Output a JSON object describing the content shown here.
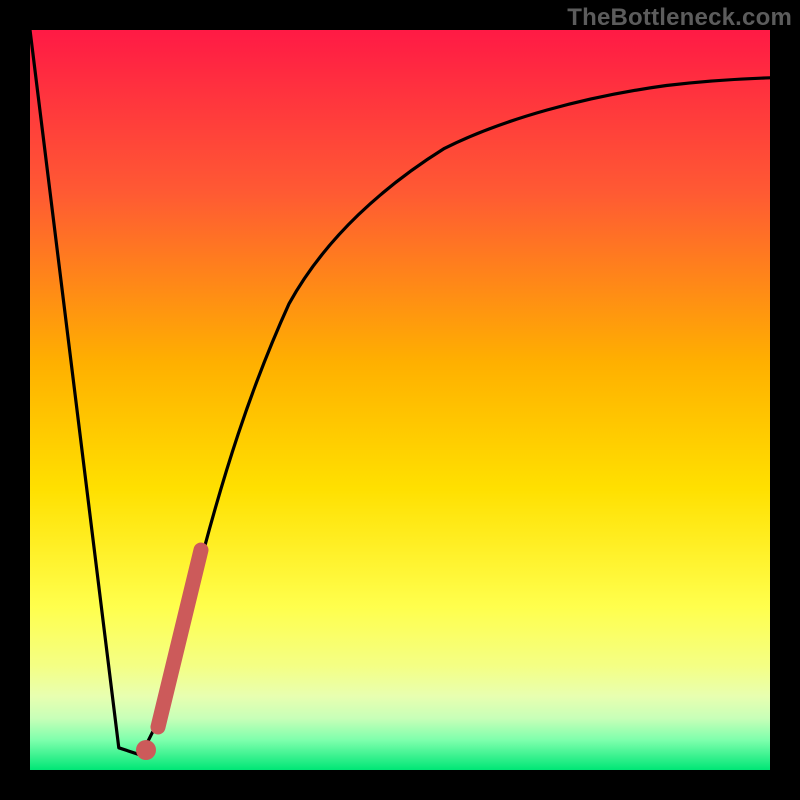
{
  "watermark": "TheBottleneck.com",
  "colors": {
    "frame": "#000000",
    "gradient_top": "#ff1a45",
    "gradient_mid_upper": "#ff7a2a",
    "gradient_mid": "#ffd400",
    "gradient_lower": "#ffff66",
    "gradient_band": "#f6ff8a",
    "gradient_bottom": "#00e676",
    "curve": "#000000",
    "highlight": "#cc5a5a"
  },
  "chart_data": {
    "type": "line",
    "title": "",
    "xlabel": "",
    "ylabel": "",
    "xlim": [
      0,
      100
    ],
    "ylim": [
      0,
      100
    ],
    "grid": false,
    "legend": false,
    "series": [
      {
        "name": "bottleneck-curve",
        "x": [
          0,
          12,
          15,
          18,
          22,
          26,
          30,
          35,
          40,
          48,
          56,
          65,
          75,
          85,
          100
        ],
        "values": [
          100,
          3,
          2,
          8,
          24,
          40,
          52,
          63,
          71,
          79,
          84,
          88,
          90.5,
          92,
          93
        ]
      }
    ],
    "annotations": [
      {
        "name": "optimal-marker",
        "x": 15.5,
        "y": 2.5
      },
      {
        "name": "highlight-segment",
        "x_range": [
          17,
          23
        ],
        "y_range": [
          6,
          30
        ]
      }
    ]
  }
}
